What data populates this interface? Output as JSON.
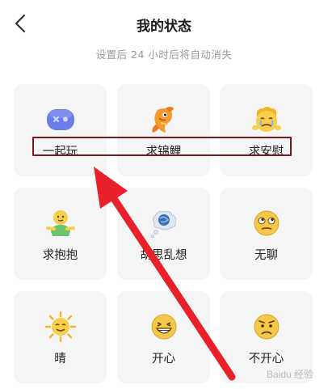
{
  "header": {
    "title": "我的状态",
    "subtitle": "设置后 24 小时后将自动消失",
    "back_icon": "chevron-left-icon"
  },
  "statuses": [
    {
      "label": "一起玩",
      "icon": "game-controller-icon"
    },
    {
      "label": "求锦鲤",
      "icon": "koi-fish-icon"
    },
    {
      "label": "求安慰",
      "icon": "crying-face-icon"
    },
    {
      "label": "求抱抱",
      "icon": "hug-person-icon"
    },
    {
      "label": "胡思乱想",
      "icon": "thought-bubble-icon"
    },
    {
      "label": "无聊",
      "icon": "bored-face-icon"
    },
    {
      "label": "晴",
      "icon": "sun-icon"
    },
    {
      "label": "开心",
      "icon": "grinning-face-icon"
    },
    {
      "label": "不开心",
      "icon": "sad-face-icon"
    }
  ],
  "annotation": {
    "arrow_color": "#e8202a",
    "box_color": "#7a1a1a"
  },
  "watermark": "Baidu 经验"
}
